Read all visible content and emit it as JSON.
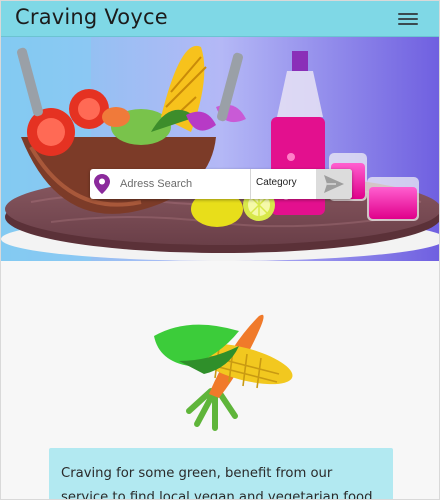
{
  "app": {
    "brand": "Craving Voyce",
    "menu_icon": "hamburger-menu-icon"
  },
  "hero": {
    "description": "Illustrated table with salad bowl, corn, lemons, bottle and pink drinks",
    "search": {
      "placeholder": "Adress Search",
      "value": "",
      "pin_icon": "location-pin-icon",
      "category_label": "Category",
      "send_icon": "send-icon"
    }
  },
  "main": {
    "intro_text": "Craving for some green, benefit from our service to find local vegan and vegetarian food"
  },
  "colors": {
    "header_bg": "#7fd8e6",
    "card_bg": "#b2e9f1",
    "pin": "#8b2a9c",
    "accent_purple": "#6f5fe0"
  }
}
